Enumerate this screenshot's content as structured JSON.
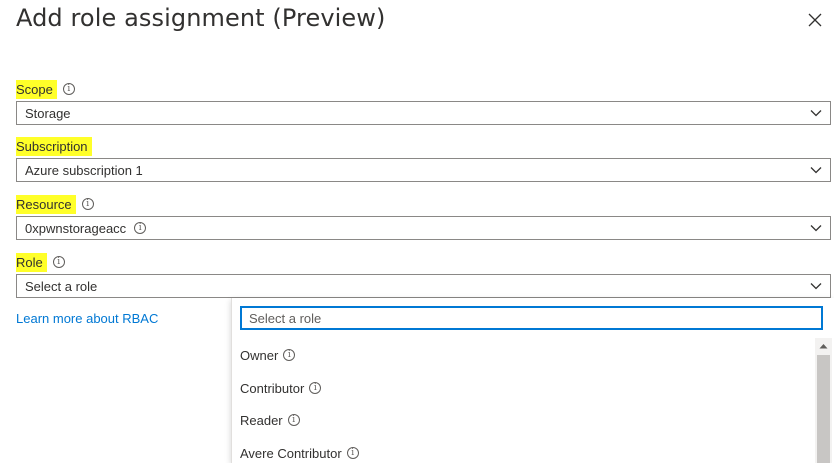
{
  "panel": {
    "title": "Add role assignment (Preview)"
  },
  "fields": {
    "scope": {
      "label": "Scope",
      "value": "Storage"
    },
    "subscription": {
      "label": "Subscription",
      "value": "Azure subscription 1"
    },
    "resource": {
      "label": "Resource",
      "value": "0xpwnstorageacc"
    },
    "role": {
      "label": "Role",
      "value": "Select a role"
    }
  },
  "learn_more": {
    "text": "Learn more about RBAC"
  },
  "role_dropdown": {
    "search_placeholder": "Select a role",
    "options": [
      {
        "label": "Owner"
      },
      {
        "label": "Contributor"
      },
      {
        "label": "Reader"
      },
      {
        "label": "Avere Contributor"
      }
    ]
  },
  "icons": {
    "info": "info-circle-icon",
    "close": "close-icon",
    "chevron": "chevron-down-icon"
  },
  "colors": {
    "highlight": "#ffff29",
    "link": "#0078d4",
    "focus_border": "#0078d4"
  }
}
